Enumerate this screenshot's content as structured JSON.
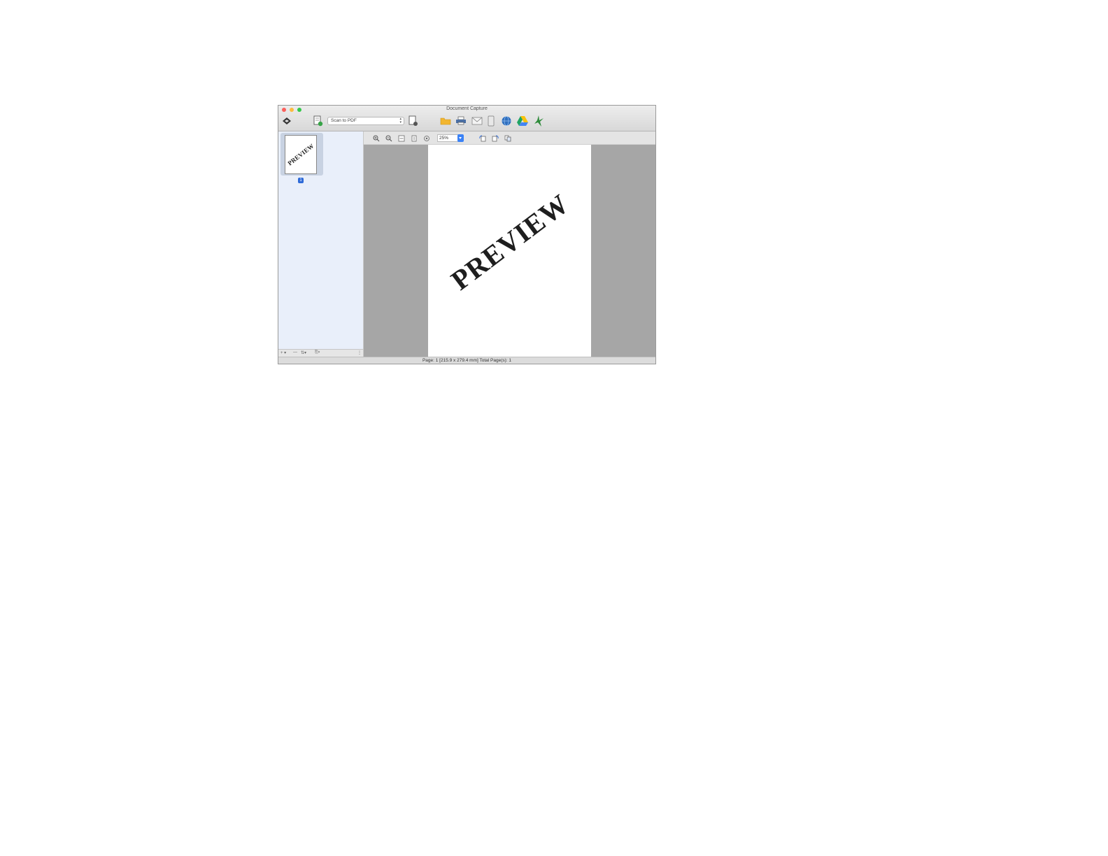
{
  "window": {
    "title": "Document Capture"
  },
  "toolbar": {
    "scan_destination": "Scan to PDF",
    "icons": [
      "scanner-logo-icon",
      "scan-document-icon",
      "scan-settings-icon",
      "folder-icon",
      "printer-icon",
      "email-icon",
      "device-icon",
      "web-icon",
      "drive-icon",
      "bird-icon"
    ]
  },
  "view_toolbar": {
    "zoom": "25%"
  },
  "sidebar": {
    "thumbnail_text": "PREVIEW",
    "page_badge": "1"
  },
  "document": {
    "page_text": "PREVIEW"
  },
  "status": {
    "text": "Page: 1  [215.9 x 279.4 mm]  Total Page(s): 1"
  },
  "colors": {
    "sidebar_bg": "#e9effa",
    "canvas_bg": "#a6a6a6",
    "accent": "#3b82f6"
  }
}
